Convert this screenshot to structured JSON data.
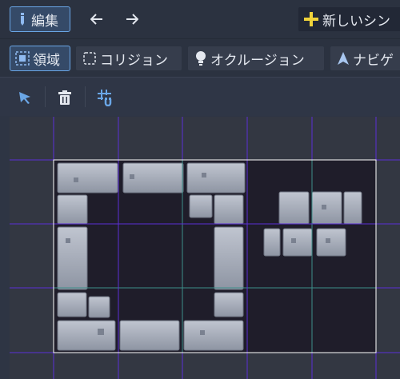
{
  "toolbar_top": {
    "edit_label": "編集",
    "new_scene_label": "新しいシン"
  },
  "mode_tabs": [
    {
      "label": "領域",
      "icon": "region-icon",
      "active": true
    },
    {
      "label": "コリジョン",
      "icon": "collision-icon",
      "active": false
    },
    {
      "label": "オクルージョン",
      "icon": "occlusion-icon",
      "active": false
    },
    {
      "label": "ナビゲ",
      "icon": "navigation-icon",
      "active": false
    }
  ],
  "tools": [
    "select-icon",
    "delete-icon",
    "grid-snap-icon"
  ],
  "colors": {
    "accent": "#6aa6e6",
    "plus": "#f0d33a",
    "grid_primary": "#5b2fd6",
    "grid_secondary": "#3c8f8a",
    "texture_bg": "#1f1d2a",
    "region_outline": "#ffffff"
  }
}
